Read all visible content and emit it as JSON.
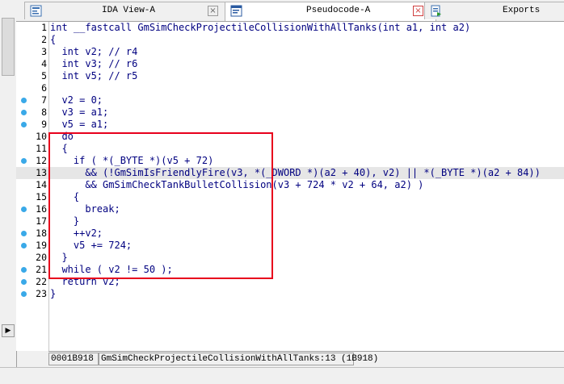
{
  "tabs": [
    {
      "label": "IDA View-A",
      "icon": "disassembly-icon",
      "active": false
    },
    {
      "label": "Pseudocode-A",
      "icon": "pseudocode-icon",
      "active": true
    },
    {
      "label": "Exports",
      "icon": "exports-icon",
      "active": false
    }
  ],
  "code": {
    "line_numbers": [
      "1",
      "2",
      "3",
      "4",
      "5",
      "6",
      "7",
      "8",
      "9",
      "10",
      "11",
      "12",
      "13",
      "14",
      "15",
      "16",
      "17",
      "18",
      "19",
      "20",
      "21",
      "22",
      "23"
    ],
    "lines": [
      "int __fastcall GmSimCheckProjectileCollisionWithAllTanks(int a1, int a2)",
      "{",
      "  int v2; // r4",
      "  int v3; // r6",
      "  int v5; // r5",
      "",
      "  v2 = 0;",
      "  v3 = a1;",
      "  v5 = a1;",
      "  do",
      "  {",
      "    if ( *(_BYTE *)(v5 + 72)",
      "      && (!GmSimIsFriendlyFire(v3, *(_DWORD *)(a2 + 40), v2) || *(_BYTE *)(a2 + 84))",
      "      && GmSimCheckTankBulletCollision(v3 + 724 * v2 + 64, a2) )",
      "    {",
      "      break;",
      "    }",
      "    ++v2;",
      "    v5 += 724;",
      "  }",
      "  while ( v2 != 50 );",
      "  return v2;",
      "}"
    ]
  },
  "status": {
    "address": "0001B918",
    "location": "GmSimCheckProjectileCollisionWithAllTanks:13 (1B918)"
  },
  "colors": {
    "highlight_box": "#e8001c",
    "breakpoint_dot": "#3aa9e8",
    "current_line": "#e6e6e6"
  }
}
